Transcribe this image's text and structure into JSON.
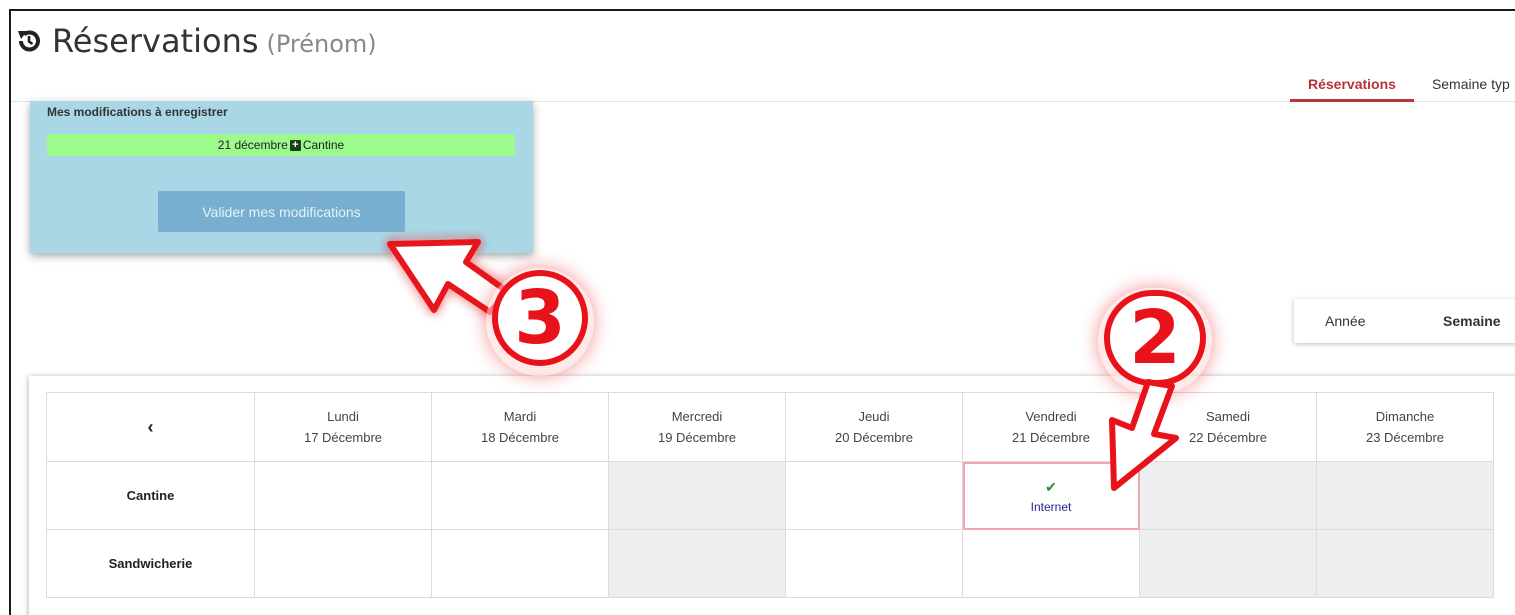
{
  "header": {
    "title": "Réservations",
    "subtitle": "(Prénom)"
  },
  "tabs": [
    {
      "label": "Réservations",
      "active": true
    },
    {
      "label": "Semaine typ",
      "active": false
    }
  ],
  "pending": {
    "title": "Mes modifications à enregistrer",
    "item_date": "21 décembre",
    "item_service": "Cantine",
    "validate_label": "Valider mes modifications"
  },
  "view_switch": {
    "annee": "Année",
    "semaine": "Semaine"
  },
  "calendar": {
    "prev_icon": "chevron-left-icon",
    "days": [
      {
        "name": "Lundi",
        "date": "17 Décembre"
      },
      {
        "name": "Mardi",
        "date": "18 Décembre"
      },
      {
        "name": "Mercredi",
        "date": "19 Décembre"
      },
      {
        "name": "Jeudi",
        "date": "20 Décembre"
      },
      {
        "name": "Vendredi",
        "date": "21 Décembre"
      },
      {
        "name": "Samedi",
        "date": "22 Décembre"
      },
      {
        "name": "Dimanche",
        "date": "23 Décembre"
      }
    ],
    "rows": [
      {
        "label": "Cantine"
      },
      {
        "label": "Sandwicherie"
      }
    ],
    "booked": {
      "status_text": "Internet",
      "icon": "check-icon"
    }
  },
  "annotations": {
    "step_3": "3",
    "step_2": "2"
  },
  "colors": {
    "accent": "#b5343a",
    "panel": "#a9d7e5",
    "pending_item": "#9dfb8c",
    "button": "#78afd0",
    "annotation_red": "#e8121b"
  }
}
